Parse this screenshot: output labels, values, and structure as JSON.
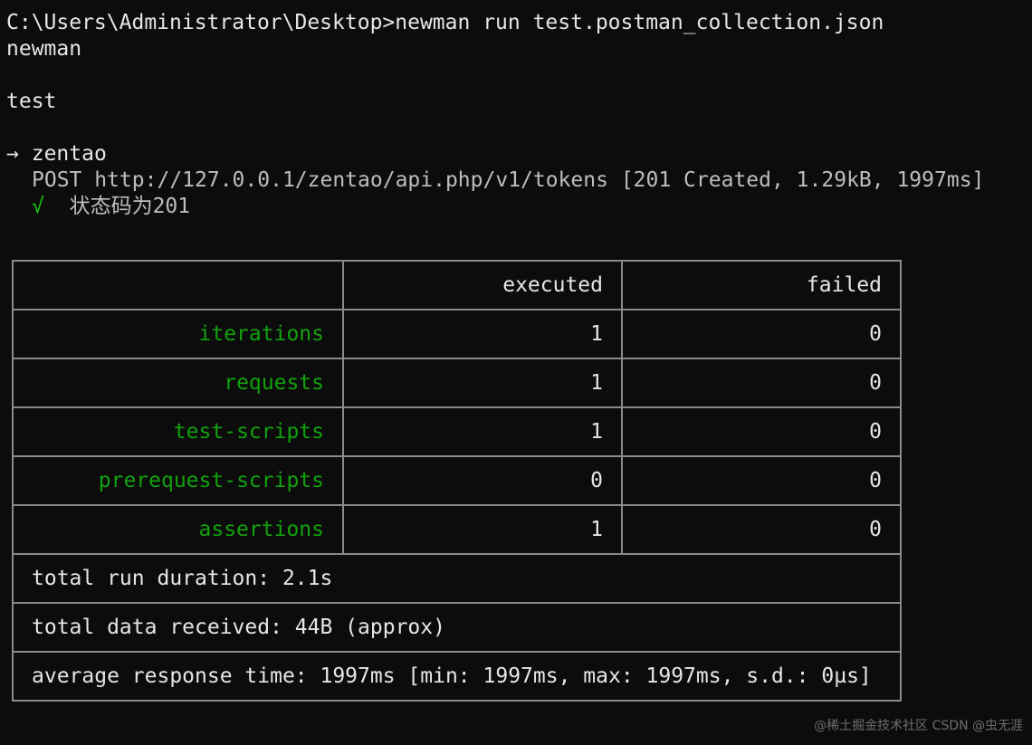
{
  "terminal": {
    "prompt_line": "C:\\Users\\Administrator\\Desktop>newman run test.postman_collection.json",
    "tool_name": "newman",
    "collection_name": "test",
    "folder": {
      "arrow": "→",
      "name": "zentao"
    },
    "request_line": "POST http://127.0.0.1/zentao/api.php/v1/tokens [201 Created, 1.29kB, 1997ms]",
    "assertion": {
      "check": "√",
      "text": "状态码为201"
    }
  },
  "summary_table": {
    "headers": [
      "",
      "executed",
      "failed"
    ],
    "rows": [
      {
        "label": "iterations",
        "executed": "1",
        "failed": "0"
      },
      {
        "label": "requests",
        "executed": "1",
        "failed": "0"
      },
      {
        "label": "test-scripts",
        "executed": "1",
        "failed": "0"
      },
      {
        "label": "prerequest-scripts",
        "executed": "0",
        "failed": "0"
      },
      {
        "label": "assertions",
        "executed": "1",
        "failed": "0"
      }
    ],
    "footer": [
      "total run duration: 2.1s",
      "total data received: 44B (approx)",
      "average response time: 1997ms [min: 1997ms, max: 1997ms, s.d.: 0µs]"
    ]
  },
  "watermark": "@稀土掘金技术社区 CSDN @虫无涯",
  "colors": {
    "background": "#0c0c0c",
    "text": "#e6e6e6",
    "green": "#16c60c",
    "table_border": "#8a8a8a"
  }
}
